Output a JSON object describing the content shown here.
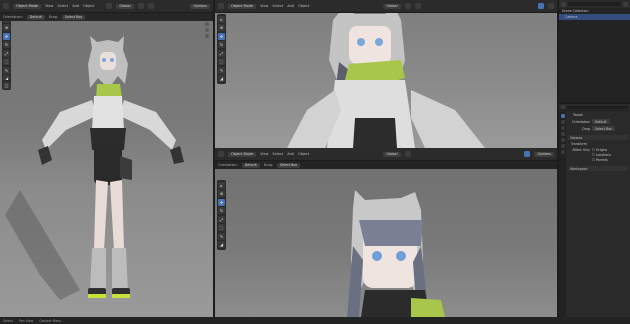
{
  "top_bar": {
    "left_menus": [
      "Object Mode",
      "View",
      "Select",
      "Add",
      "Object"
    ],
    "orientation_label": "Orientation:",
    "orientation_value": "Default",
    "drag_label": "Drag:",
    "drag_value": "Select Box",
    "transform": "Global",
    "options": "Options"
  },
  "viewport_top_right": {
    "menus": [
      "Object Mode",
      "View",
      "Select",
      "Add",
      "Object"
    ],
    "transform": "Global",
    "options": "Options"
  },
  "viewport_bottom_right": {
    "menus": [
      "Object Mode",
      "View",
      "Select",
      "Add",
      "Object"
    ],
    "orientation_label": "Orientation:",
    "orientation_value": "Default",
    "drag_label": "Drag:",
    "drag_value": "Select Box",
    "transform": "Global",
    "options": "Options"
  },
  "outliner": {
    "rows": [
      "Scene Collection",
      "Camera"
    ]
  },
  "properties": {
    "section": "Active Tool",
    "tool_name": "Tweak",
    "orientation_label": "Orientation",
    "orientation_value": "Default",
    "drag_label": "Drag",
    "drag_value": "Select Box",
    "options_header": "Options",
    "transform_header": "Transform",
    "affect_only_label": "Affect Only",
    "checkboxes": [
      "Origins",
      "Locations",
      "Parents"
    ],
    "workspace_header": "Workspace"
  },
  "status_bar": {
    "items": [
      "Select",
      "Pan View",
      "Context Menu"
    ]
  },
  "colors": {
    "accent": "#4772b3",
    "lime": "#c3e23a",
    "header": "#2b2b2b"
  }
}
